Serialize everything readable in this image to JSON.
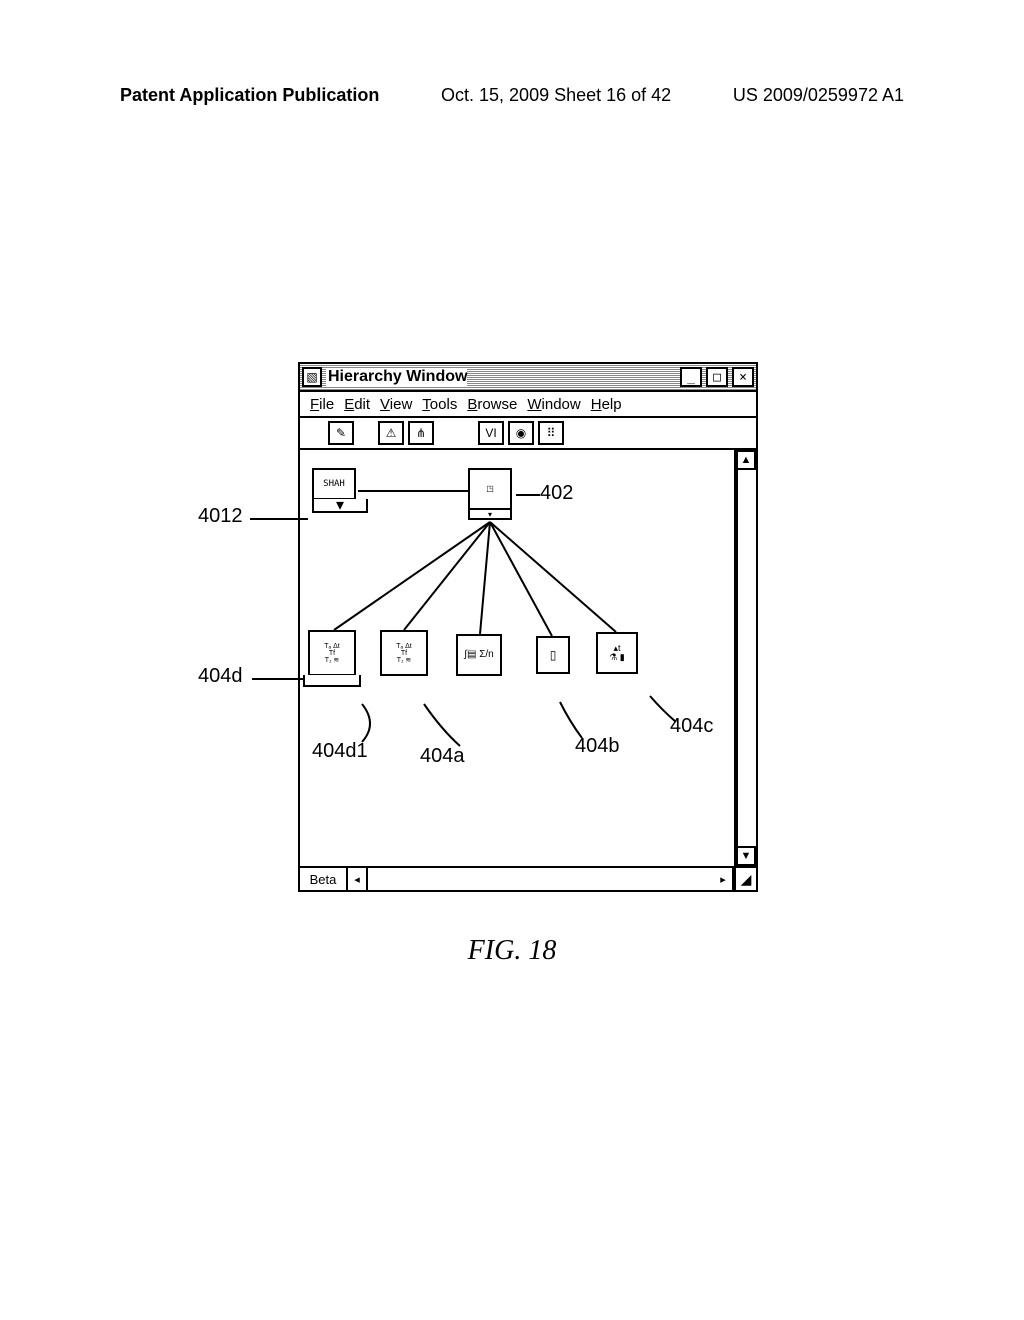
{
  "page_header": {
    "left": "Patent Application Publication",
    "center": "Oct. 15, 2009  Sheet 16 of 42",
    "right": "US 2009/0259972 A1"
  },
  "window": {
    "title": "Hierarchy Window",
    "menus": {
      "file": "File",
      "edit": "Edit",
      "view": "View",
      "tools": "Tools",
      "browse": "Browse",
      "window": "Window",
      "help": "Help"
    },
    "statusbar_label": "Beta"
  },
  "diagram": {
    "root_label": "SHAH"
  },
  "annotations": {
    "a4012": "4012",
    "a402": "402",
    "a404d": "404d",
    "a404d1": "404d1",
    "a404a": "404a",
    "a404b": "404b",
    "a404c": "404c"
  },
  "figure_caption": "FIG. 18"
}
